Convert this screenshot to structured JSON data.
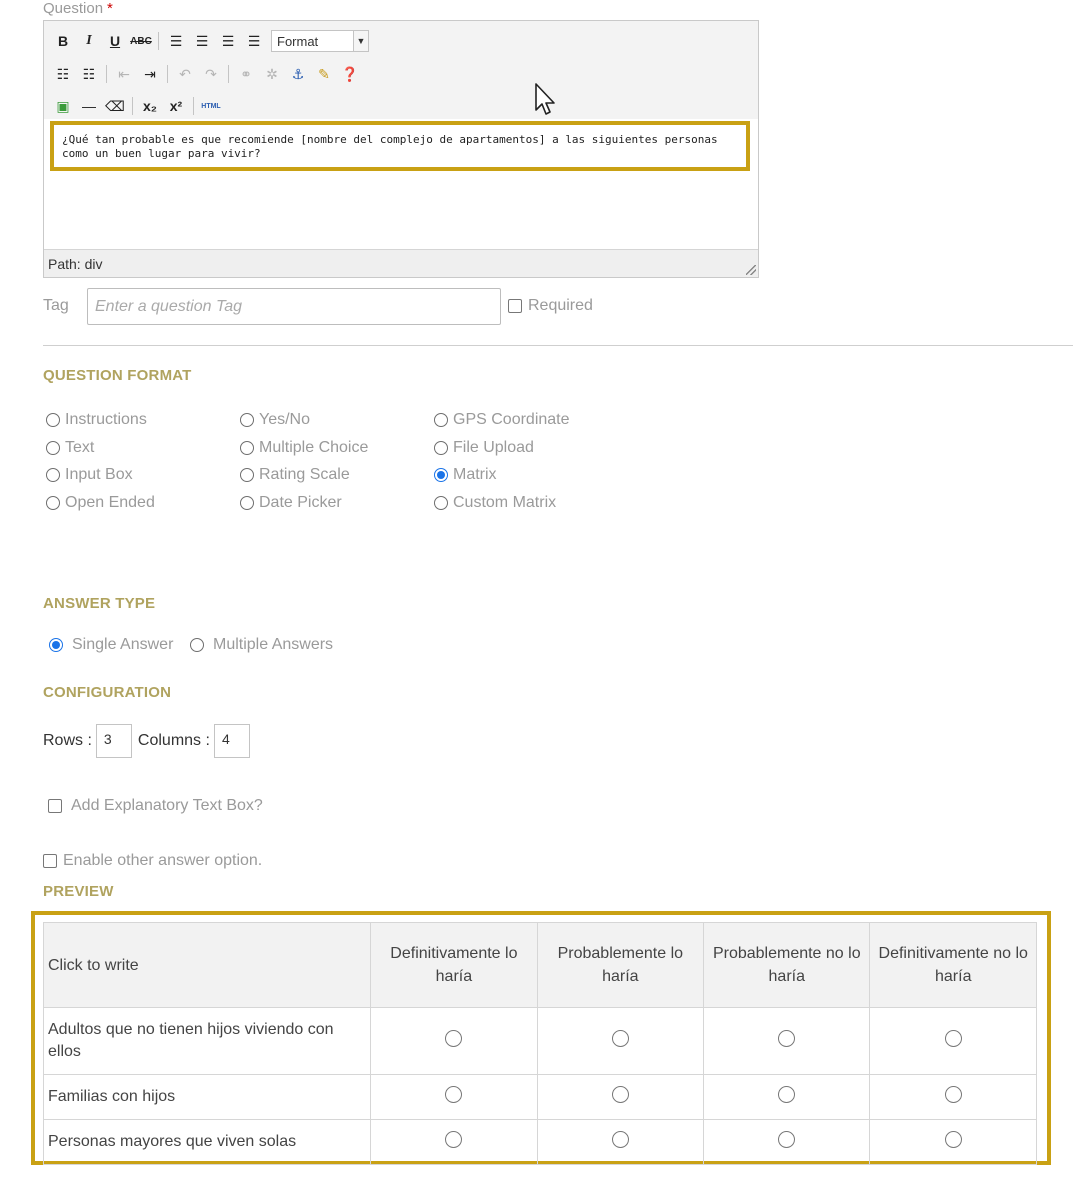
{
  "question": {
    "label": "Question",
    "required_mark": "*"
  },
  "editor": {
    "format_label": "Format",
    "content": "¿Qué tan probable es que recomiende [nombre del complejo de apartamentos] a las siguientes personas como un buen lugar para vivir?",
    "path_label": "Path: div"
  },
  "tag": {
    "label": "Tag",
    "placeholder": "Enter a question Tag",
    "required_label": "Required"
  },
  "question_format": {
    "heading": "QUESTION FORMAT",
    "options": [
      "Instructions",
      "Text",
      "Input Box",
      "Open Ended",
      "Yes/No",
      "Multiple Choice",
      "Rating Scale",
      "Date Picker",
      "GPS Coordinate",
      "File Upload",
      "Matrix",
      "Custom Matrix"
    ],
    "selected": "Matrix"
  },
  "answer_type": {
    "heading": "ANSWER TYPE",
    "single": "Single Answer",
    "multiple": "Multiple Answers",
    "selected": "Single Answer"
  },
  "configuration": {
    "heading": "CONFIGURATION",
    "rows_label": "Rows :",
    "rows": "3",
    "columns_label": "Columns :",
    "columns": "4"
  },
  "explanatory_label": "Add Explanatory Text Box?",
  "other_answer_label": "Enable other answer option.",
  "preview": {
    "heading": "PREVIEW",
    "corner": "Click to write",
    "columns": [
      "Definitivamente lo haría",
      "Probablemente lo haría",
      "Probablemente no lo haría",
      "Definitivamente no lo haría"
    ],
    "rows": [
      "Adultos que no tienen hijos viviendo con ellos",
      "Familias con hijos",
      "Personas mayores que viven solas"
    ]
  },
  "colors": {
    "highlight": "#c9a114",
    "section": "#b0a35f",
    "radio_selected": "#1a73e8"
  }
}
